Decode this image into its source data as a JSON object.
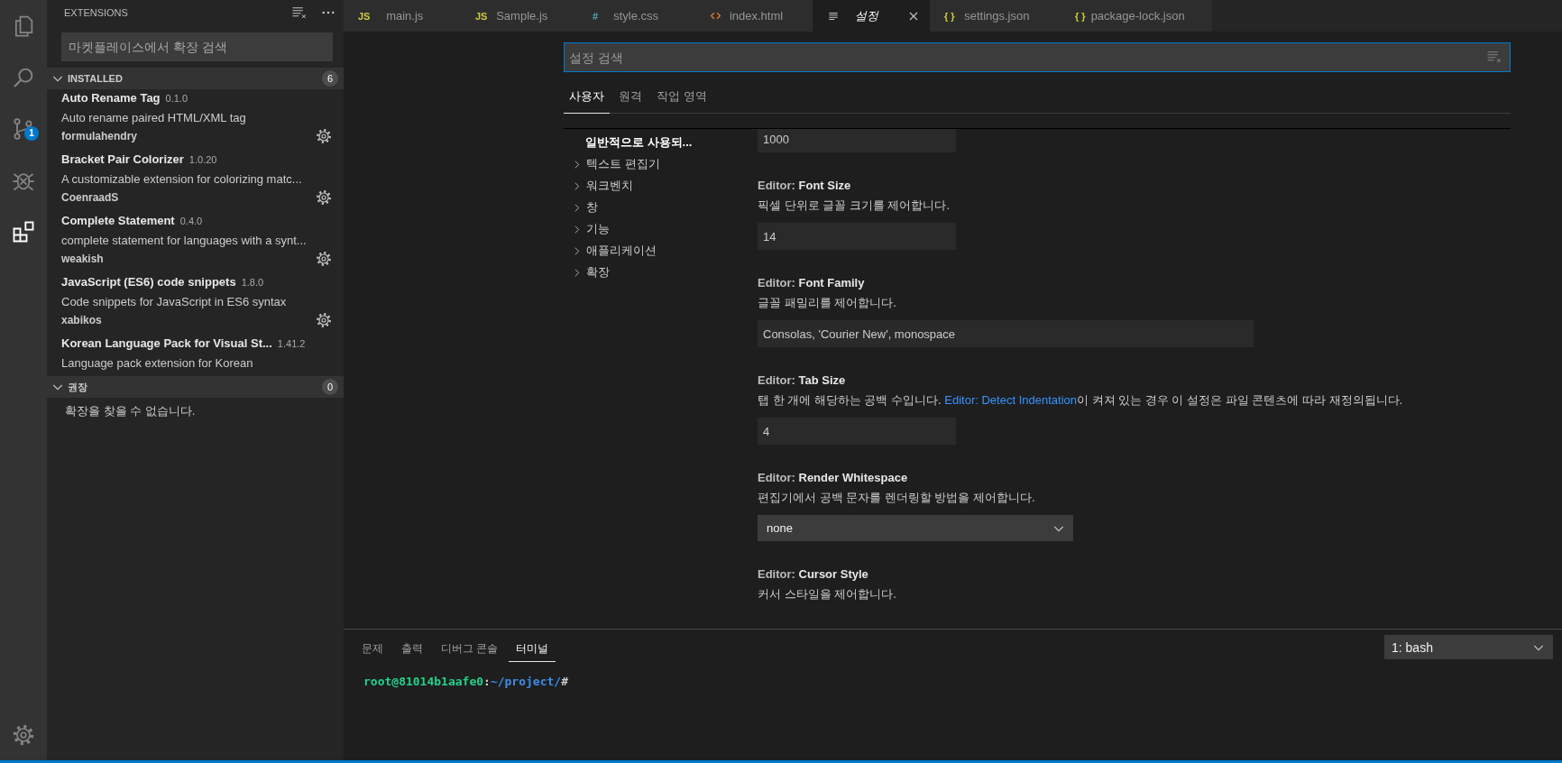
{
  "activity_bar": {
    "items": [
      {
        "kind": "files",
        "selected": false
      },
      {
        "kind": "search",
        "selected": false
      },
      {
        "kind": "scm",
        "selected": false,
        "badge": "1"
      },
      {
        "kind": "debug",
        "selected": false
      },
      {
        "kind": "extensions",
        "selected": true
      }
    ],
    "bottom": [
      {
        "kind": "settings",
        "selected": false
      }
    ]
  },
  "sidebar": {
    "title": "EXTENSIONS",
    "search": {
      "placeholder": "마켓플레이스에서 확장 검색"
    },
    "sections": [
      {
        "title": "INSTALLED",
        "count": "6",
        "expanded": true,
        "extensions": [
          {
            "name": "Auto Rename Tag",
            "version": "0.1.0",
            "description": "Auto rename paired HTML/XML tag",
            "publisher": "formulahendry"
          },
          {
            "name": "Bracket Pair Colorizer",
            "version": "1.0.20",
            "description": "A customizable extension for colorizing matc...",
            "publisher": "CoenraadS"
          },
          {
            "name": "Complete Statement",
            "version": "0.4.0",
            "description": "complete statement for languages with a synt...",
            "publisher": "weakish"
          },
          {
            "name": "JavaScript (ES6) code snippets",
            "version": "1.8.0",
            "description": "Code snippets for JavaScript in ES6 syntax",
            "publisher": "xabikos"
          },
          {
            "name": "Korean Language Pack for Visual St...",
            "version": "1.41.2",
            "description": "Language pack extension for Korean"
          }
        ]
      },
      {
        "title": "권장",
        "count": "0",
        "expanded": true,
        "empty_message": "확장을 찾을 수 없습니다."
      }
    ]
  },
  "tabs": [
    {
      "label": "main.js",
      "kind": "js",
      "icon": "JS",
      "selected": false
    },
    {
      "label": "Sample.js",
      "kind": "js",
      "icon": "JS",
      "selected": false
    },
    {
      "label": "style.css",
      "kind": "css",
      "icon": "#",
      "selected": false
    },
    {
      "label": "index.html",
      "kind": "html",
      "selected": false
    },
    {
      "label": "설정",
      "kind": "settings",
      "selected": true
    },
    {
      "label": "settings.json",
      "kind": "json",
      "icon": "{ }",
      "selected": false
    },
    {
      "label": "package-lock.json",
      "kind": "json",
      "icon": "{ }",
      "selected": false
    }
  ],
  "settings": {
    "search": {
      "placeholder": "설정 검색"
    },
    "scopes": [
      {
        "label": "사용자",
        "selected": true
      },
      {
        "label": "원격",
        "selected": false
      },
      {
        "label": "작업 영역",
        "selected": false
      }
    ],
    "toc": [
      {
        "label": "일반적으로 사용되...",
        "expandable": false,
        "selected": true
      },
      {
        "label": "텍스트 편집기",
        "expandable": true,
        "selected": false
      },
      {
        "label": "워크벤치",
        "expandable": true,
        "selected": false
      },
      {
        "label": "창",
        "expandable": true,
        "selected": false
      },
      {
        "label": "기능",
        "expandable": true,
        "selected": false
      },
      {
        "label": "애플리케이션",
        "expandable": true,
        "selected": false
      },
      {
        "label": "확장",
        "expandable": true,
        "selected": false
      }
    ],
    "items": [
      {
        "kind": "number",
        "value": "1000"
      },
      {
        "kind": "number",
        "category": "Editor:",
        "title": "Font Size",
        "description": "픽셀 단위로 글꼴 크기를 제어합니다.",
        "value": "14"
      },
      {
        "kind": "text",
        "category": "Editor:",
        "title": "Font Family",
        "description": "글꼴 패밀리를 제어합니다.",
        "value": "Consolas, 'Courier New', monospace"
      },
      {
        "kind": "number",
        "category": "Editor:",
        "title": "Tab Size",
        "description": "탭 한 개에 해당하는 공백 수입니다. ",
        "link": "Editor: Detect Indentation",
        "description_after": "이 켜져 있는 경우 이 설정은 파일 콘텐츠에 따라 재정의됩니다.",
        "value": "4"
      },
      {
        "kind": "select",
        "category": "Editor:",
        "title": "Render Whitespace",
        "description": "편집기에서 공백 문자를 렌더링할 방법을 제어합니다.",
        "value": "none"
      },
      {
        "kind": "heading",
        "category": "Editor:",
        "title": "Cursor Style",
        "description": "커서 스타일을 제어합니다."
      }
    ]
  },
  "panel": {
    "tabs": [
      {
        "label": "문제",
        "selected": false
      },
      {
        "label": "출력",
        "selected": false
      },
      {
        "label": "디버그 콘솔",
        "selected": false
      },
      {
        "label": "터미널",
        "selected": true
      }
    ],
    "terminal_select": "1: bash",
    "prompt": {
      "user_host": "root@81014b1aafe0",
      "separator": ":",
      "path": "~/project/",
      "symbol": "#"
    }
  }
}
